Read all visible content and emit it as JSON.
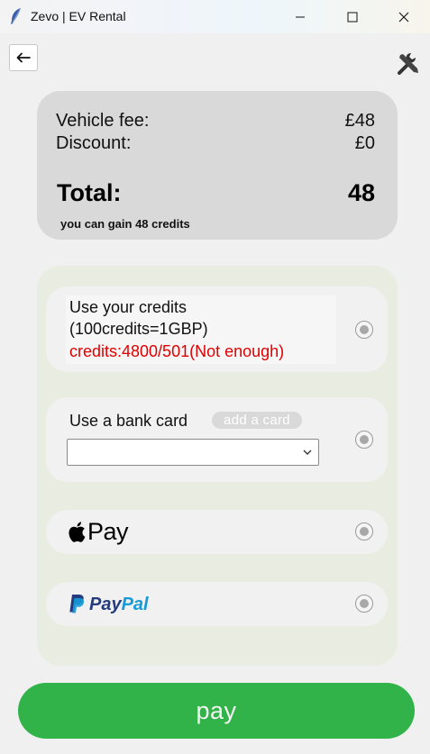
{
  "window": {
    "title": "Zevo | EV Rental",
    "icons": [
      "feather-icon",
      "minimize-icon",
      "maximize-icon",
      "close-icon"
    ]
  },
  "toolbar": {
    "back_icon": "arrow-left-icon",
    "settings_icon": "tools-icon"
  },
  "summary": {
    "vehicle_fee_label": "Vehicle fee:",
    "vehicle_fee_value": "£48",
    "discount_label": "Discount:",
    "discount_value": "£0",
    "total_label": "Total:",
    "total_value": "48",
    "credits_note": "you can gain 48 credits"
  },
  "payment": {
    "credits_line1": "Use your credits",
    "credits_line2": "(100credits=1GBP)",
    "credits_status": "credits:4800/501(Not enough)",
    "bank_label": "Use a bank card",
    "add_card_label": "add a card",
    "card_select_value": "",
    "apple_pay_label": "Pay",
    "paypal_label_pay": "Pay",
    "paypal_label_pal": "Pal"
  },
  "pay_button": {
    "label": "pay"
  },
  "colors": {
    "pay_green": "#32b34a",
    "status_red": "#e00000",
    "paypal_dark": "#253b80",
    "paypal_light": "#179bd7"
  }
}
